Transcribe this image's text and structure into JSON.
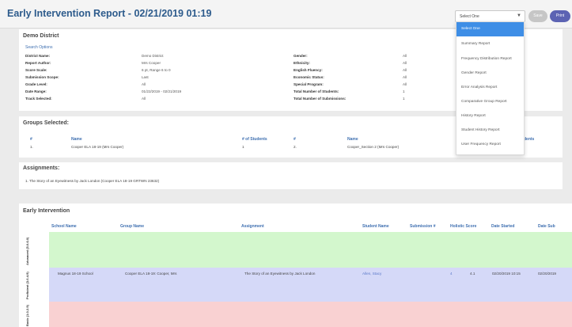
{
  "header": {
    "title": "Early Intervention Report - 02/21/2019 01:19",
    "report_select_value": "Select One",
    "save_label": "Save",
    "print_label": "Print"
  },
  "dropdown": {
    "options": [
      "Select One",
      "Summary Report",
      "Frequency Distribution Report",
      "Gender Report",
      "Error Analysis Report",
      "Comparative Group Report",
      "History Report",
      "Student History Report",
      "User Frequency Report"
    ],
    "selected": "Select One"
  },
  "summary": {
    "district": "Demo District",
    "search_options_label": "Search Options",
    "left_fields": [
      {
        "label": "District Name:",
        "value": "Demo District"
      },
      {
        "label": "Report Author:",
        "value": "Mrs Cooper"
      },
      {
        "label": "Score Scale:",
        "value": "6 pt, Range 6 to 0"
      },
      {
        "label": "Submission Scope:",
        "value": "Last"
      },
      {
        "label": "Grade Level:",
        "value": "All"
      },
      {
        "label": "Date Range:",
        "value": "01/22/2019 - 02/21/2019"
      },
      {
        "label": "Track Selected:",
        "value": "All"
      }
    ],
    "right_fields": [
      {
        "label": "Gender:",
        "value": "All"
      },
      {
        "label": "Ethnicity:",
        "value": "All"
      },
      {
        "label": "English Fluency:",
        "value": "All"
      },
      {
        "label": "Economic Status:",
        "value": "All"
      },
      {
        "label": "Special Program:",
        "value": "All"
      },
      {
        "label": "Total Number of Students:",
        "value": "1"
      },
      {
        "label": "Total Number of Submissions:",
        "value": "1"
      }
    ]
  },
  "groups": {
    "title": "Groups Selected:",
    "headers": [
      "#",
      "Name",
      "# of Students",
      "#",
      "Name",
      "dents"
    ],
    "row": [
      "1.",
      "Cooper ELA 18-19 (Mrs Cooper)",
      "1",
      "2.",
      "Cooper_Section 2 (Mrs Cooper)"
    ]
  },
  "assignments": {
    "title": "Assignments:",
    "items": [
      "1. The Story of an Eyewitness by Jack London (Cooper ELA 18-19 GRTWN 23632)"
    ]
  },
  "early_intervention": {
    "title": "Early Intervention",
    "headers": [
      "School Name",
      "Group Name",
      "Assignment",
      "Student Name",
      "Submission #",
      "Holistic Score",
      "Date Started",
      "Date Sub"
    ],
    "bands": [
      "Advanced (5.0-6.0)",
      "Proficient (3.0-4.9)",
      "Basic (1.0-2.9)"
    ],
    "row": {
      "school": "Magnus 18-19 School",
      "group": "Cooper ELA 18-19: Cooper, Mrs",
      "assignment": "The Story of an Eyewitness by Jack London",
      "student": "Allen, Stacy",
      "submission": "4",
      "score": "4.1",
      "date_started": "02/20/2019 10:15",
      "date_submitted": "02/20/2019"
    }
  },
  "colors": {
    "title_blue": "#2d5b8c",
    "link_blue": "#3e6fb0",
    "advanced_band": "#d3f7cd",
    "proficient_band": "#d5d9f8",
    "basic_band": "#f9d1d2",
    "dropdown_active": "#3e8ee6",
    "print_button": "#5c63b3"
  }
}
